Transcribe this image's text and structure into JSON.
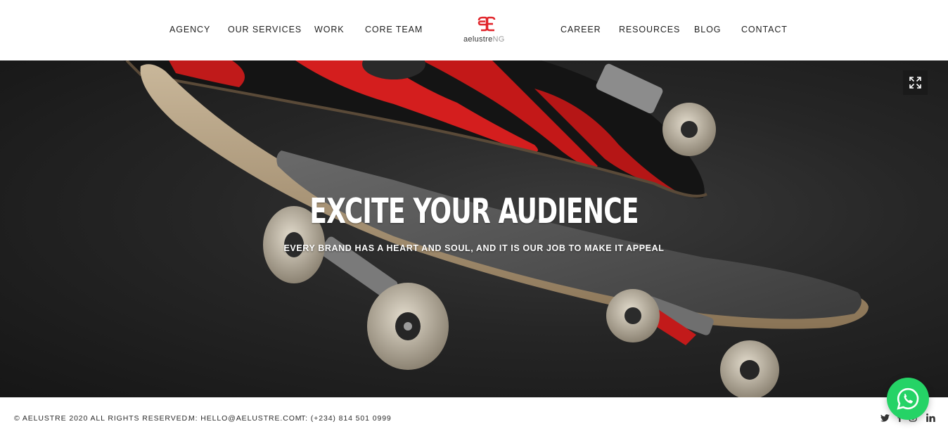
{
  "nav": {
    "left": [
      "AGENCY",
      "OUR SERVICES",
      "WORK",
      "CORE TEAM"
    ],
    "right": [
      "CAREER",
      "RESOURCES",
      "BLOG",
      "CONTACT"
    ],
    "logo_text_main": "aelustre",
    "logo_text_suffix": "NG"
  },
  "hero": {
    "title": "EXCITE YOUR AUDIENCE",
    "subtitle": "EVERY BRAND HAS A HEART AND SOUL, AND IT IS OUR JOB TO MAKE IT APPEAL",
    "fullscreen_icon": "expand-icon"
  },
  "footer": {
    "copyright": "© AELUSTRE 2020 ALL RIGHTS RESERVED.",
    "email": "M: HELLO@AELUSTRE.COM",
    "phone": "T: (+234) 814 501 0999",
    "social_icons": [
      "twitter-icon",
      "facebook-icon",
      "instagram-icon",
      "linkedin-icon"
    ]
  },
  "colors": {
    "brand_red": "#e1252b",
    "whatsapp_green": "#25d366",
    "hero_bg": "#262626"
  }
}
